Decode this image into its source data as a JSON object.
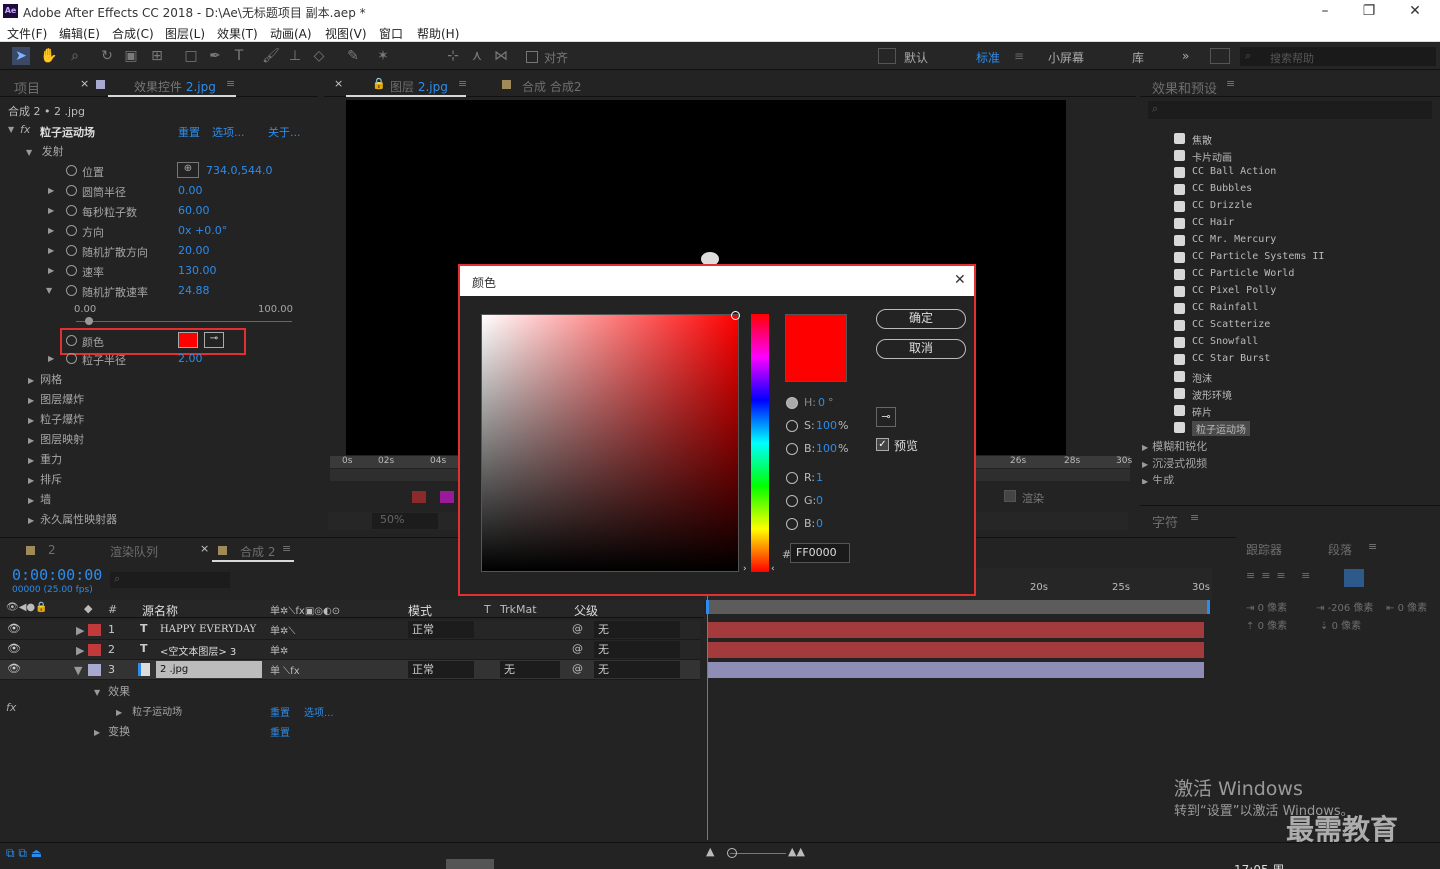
{
  "app": {
    "title": "Adobe After Effects CC 2018 - D:\\Ae\\无标题项目 副本.aep *",
    "logo": "Ae"
  },
  "menu": [
    "文件(F)",
    "编辑(E)",
    "合成(C)",
    "图层(L)",
    "效果(T)",
    "动画(A)",
    "视图(V)",
    "窗口",
    "帮助(H)"
  ],
  "toolbar": {
    "snap": "对齐",
    "workspaces": [
      "默认",
      "标准",
      "小屏幕",
      "库"
    ],
    "active_ws": "标准",
    "search": "搜索帮助"
  },
  "left": {
    "tab_project": "项目",
    "tab_effects": "效果控件 2.jpg",
    "crumb": "合成 2 • 2 .jpg",
    "effect": {
      "name": "粒子运动场",
      "reset": "重置",
      "options": "选项...",
      "about": "关于..."
    },
    "group": "发射",
    "props": [
      {
        "label": "位置",
        "value": "734.0,544.0"
      },
      {
        "label": "圆筒半径",
        "value": "0.00"
      },
      {
        "label": "每秒粒子数",
        "value": "60.00"
      },
      {
        "label": "方向",
        "value": "0x +0.0°"
      },
      {
        "label": "随机扩散方向",
        "value": "20.00"
      },
      {
        "label": "速率",
        "value": "130.00"
      },
      {
        "label": "随机扩散速率",
        "value": "24.88"
      }
    ],
    "slider": {
      "min": "0.00",
      "max": "100.00",
      "value": 0.06
    },
    "color_label": "颜色",
    "color_value": "#ff0000",
    "radius_label": "粒子半径",
    "radius_value": "2.00",
    "more": [
      "网格",
      "图层爆炸",
      "粒子爆炸",
      "图层映射",
      "重力",
      "排斥",
      "墙",
      "永久属性映射器"
    ]
  },
  "center": {
    "tab_layer": "图层 2.jpg",
    "tab_comp": "合成 合成2",
    "ruler": [
      "0s",
      "02s",
      "04s",
      "26s",
      "28s",
      "30s"
    ],
    "zoom": "50%",
    "render": "渲染"
  },
  "dialog": {
    "title": "颜色",
    "ok": "确定",
    "cancel": "取消",
    "preview": "预览",
    "H": "0",
    "S": "100",
    "B": "100",
    "R": "1",
    "G": "0",
    "Bb": "0",
    "hex": "FF0000",
    "deg": "°",
    "pct": "%",
    "hash": "#",
    "lab_h": "H:",
    "lab_s": "S:",
    "lab_b": "B:",
    "lab_r": "R:",
    "lab_g": "G:",
    "lab_bb": "B:"
  },
  "right": {
    "tab": "效果和预设",
    "items": [
      "焦散",
      "卡片动画",
      "CC Ball Action",
      "CC Bubbles",
      "CC Drizzle",
      "CC Hair",
      "CC Mr. Mercury",
      "CC Particle Systems II",
      "CC Particle World",
      "CC Pixel Polly",
      "CC Rainfall",
      "CC Scatterize",
      "CC Snowfall",
      "CC Star Burst",
      "泡沫",
      "波形环境",
      "碎片",
      "粒子运动场"
    ],
    "folders": [
      "模糊和锐化",
      "沉浸式视频",
      "生成"
    ],
    "char_tab": "字符",
    "tracker": "跟踪器",
    "para": "段落",
    "para_vals": [
      "0 像素",
      "-206 像素",
      "0 像素",
      "0 像素",
      "0 像素"
    ]
  },
  "timeline": {
    "tab_queue": "渲染队列",
    "tab_comp": "合成 2",
    "num": "2",
    "timecode": "0:00:00:00",
    "fps": "00000 (25.00 fps)",
    "cols": {
      "num": "#",
      "name": "源名称",
      "mode": "模式",
      "t": "T",
      "trk": "TrkMat",
      "parent": "父级"
    },
    "layers": [
      {
        "n": "1",
        "type": "T",
        "name": "HAPPY EVERYDAY",
        "mode": "正常",
        "trk": "",
        "parent": "无",
        "color": "#c0393b"
      },
      {
        "n": "2",
        "type": "T",
        "name": "<空文本图层> 3",
        "mode": "",
        "trk": "",
        "parent": "无",
        "color": "#c0393b"
      },
      {
        "n": "3",
        "type": "img",
        "name": "2 .jpg",
        "mode": "正常",
        "trk": "无",
        "parent": "无",
        "color": "#a9a9cf"
      }
    ],
    "sub": {
      "effects": "效果",
      "fx": "粒子运动场",
      "reset": "重置",
      "options": "选项...",
      "transform": "变换",
      "reset2": "重置"
    },
    "ruler": [
      "20s",
      "25s",
      "30s"
    ]
  },
  "watermark": {
    "line1": "激活 Windows",
    "line2": "转到“设置”以激活 Windows。",
    "brand": "最需教育"
  },
  "status": {
    "time": "17:05 周"
  }
}
